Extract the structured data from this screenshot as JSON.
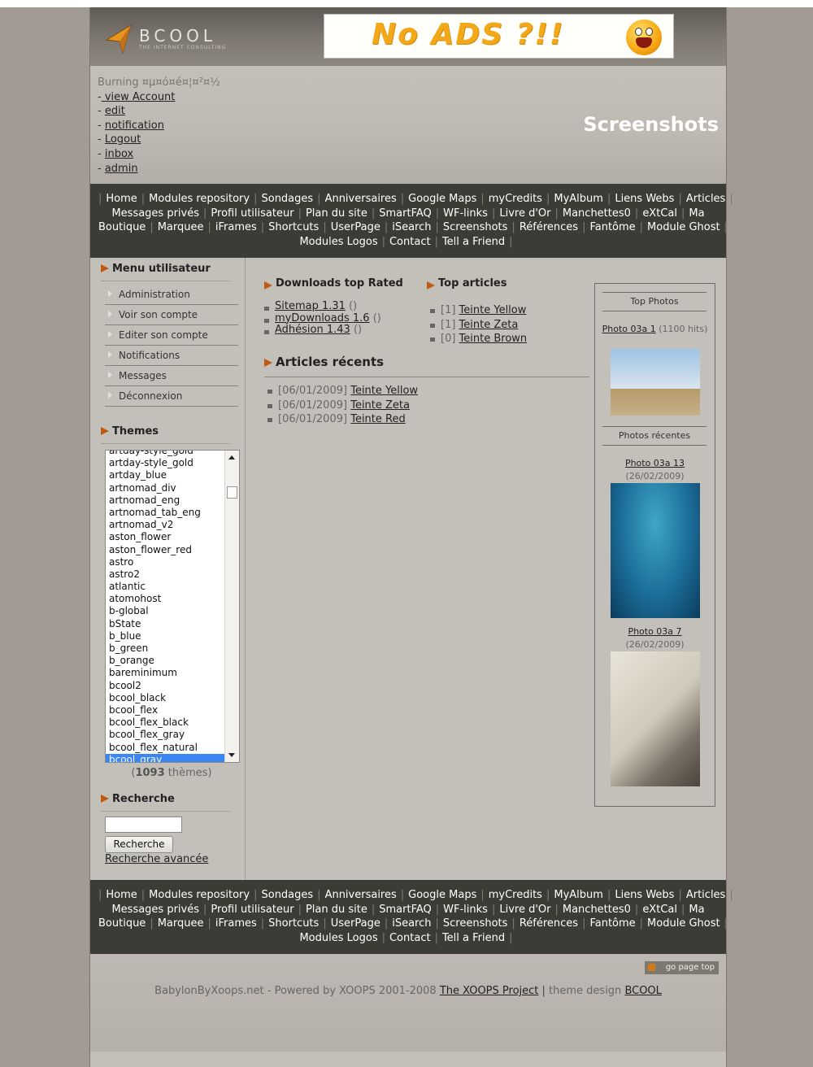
{
  "header": {
    "logo_name": "BCOOL",
    "logo_tagline": "THE INTERNET CONSULTING",
    "banner_text": "No ADS ?!!"
  },
  "user": {
    "name": "Burning ¤µ¤ó¤é¤¦¤²¤½",
    "links": [
      " view Account",
      "edit",
      "notification",
      "Logout",
      "inbox",
      "admin"
    ],
    "prefix": "-"
  },
  "page_title": "Screenshots",
  "nav": {
    "items": [
      "Home",
      "Modules repository",
      "Sondages",
      "Anniversaires",
      "Google Maps",
      "myCredits",
      "MyAlbum",
      "Liens Webs",
      "Articles",
      "Messages privés",
      "Profil utilisateur",
      "Plan du site",
      "SmartFAQ",
      "WF-links",
      "Livre d'Or",
      "Manchettes0",
      "eXtCal",
      "Ma Boutique",
      "Marquee",
      "iFrames",
      "Shortcuts",
      "UserPage",
      "iSearch",
      "Screenshots",
      "Références",
      "Fantôme",
      "Module Ghost",
      "Modules Logos",
      "Contact",
      "Tell a Friend"
    ],
    "separator": "|"
  },
  "left": {
    "menu_title": "Menu utilisateur",
    "menu_items": [
      "Administration",
      "Voir son compte",
      "Editer son compte",
      "Notifications",
      "Messages",
      "Déconnexion"
    ],
    "themes_title": "Themes",
    "themes": [
      "artday-style_gold",
      "artday-style_gold",
      "artday_blue",
      "artnomad_div",
      "artnomad_eng",
      "artnomad_tab_eng",
      "artnomad_v2",
      "aston_flower",
      "aston_flower_red",
      "astro",
      "astro2",
      "atlantic",
      "atomohost",
      "b-global",
      "bState",
      "b_blue",
      "b_green",
      "b_orange",
      "bareminimum",
      "bcool2",
      "bcool_black",
      "bcool_flex",
      "bcool_flex_black",
      "bcool_flex_gray",
      "bcool_flex_natural",
      "bcool_gray"
    ],
    "selected_theme": "bcool_gray",
    "themes_count_open": "(",
    "themes_count": "1093",
    "themes_count_close": " thèmes)",
    "search_title": "Recherche",
    "search_value": "",
    "search_button": "Recherche",
    "advanced_search": "Recherche avancée"
  },
  "center": {
    "downloads_title": "Downloads top Rated",
    "downloads": [
      {
        "link": "Sitemap 1.31",
        "extra": " ()"
      },
      {
        "link": "myDownloads 1.6",
        "extra": " ()"
      },
      {
        "link": "Adhésion 1.43",
        "extra": " ()"
      }
    ],
    "top_articles_title": "Top articles",
    "top_articles": [
      {
        "count": "[1] ",
        "link": "Teinte Yellow"
      },
      {
        "count": "[1] ",
        "link": "Teinte Zeta"
      },
      {
        "count": "[0] ",
        "link": "Teinte Brown"
      }
    ],
    "recent_title": "Articles récents",
    "recent": [
      {
        "date": "[06/01/2009] ",
        "link": "Teinte Yellow"
      },
      {
        "date": "[06/01/2009] ",
        "link": "Teinte Zeta"
      },
      {
        "date": "[06/01/2009] ",
        "link": "Teinte Red"
      }
    ]
  },
  "right": {
    "top_photos_title": "Top Photos",
    "top_photo": {
      "title": "Photo 03a 1",
      "meta": " (1100 hits)"
    },
    "recent_photos_title": "Photos récentes",
    "recent_photos": [
      {
        "title": "Photo 03a 13",
        "meta": "(26/02/2009)"
      },
      {
        "title": "Photo 03a 7",
        "meta": "(26/02/2009)"
      }
    ]
  },
  "footer": {
    "go_top": "go page top",
    "text": "BabylonByXoops.net - Powered by XOOPS 2001-2008 ",
    "xoops_link": "The XOOPS Project",
    "sep": " | ",
    "design_text": "theme design ",
    "design_link": "BCOOL"
  },
  "colors": {
    "nav_bg": "#3c3c37",
    "page_bg": "#c2c0b8",
    "outer_bg": "#a39a93",
    "arrow": "#c05a12",
    "selected": "#3a86f5"
  }
}
